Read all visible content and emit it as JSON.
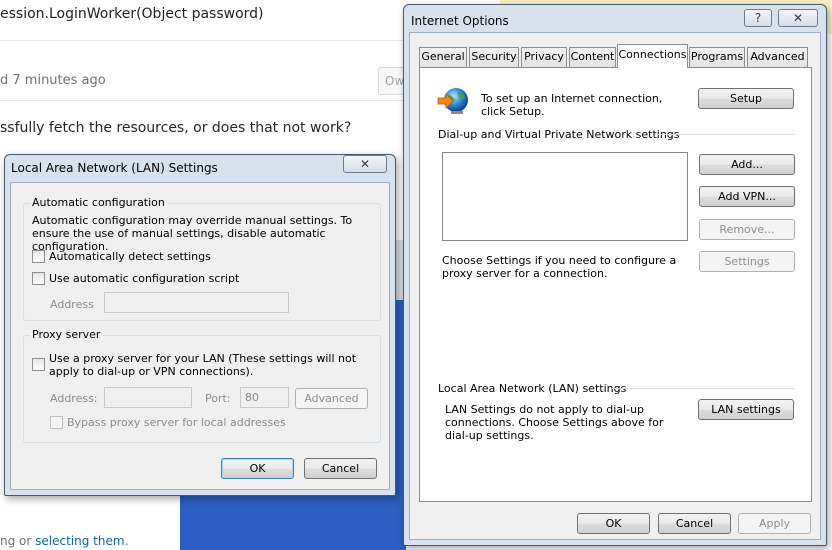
{
  "background": {
    "code_line": "ession.LoginWorker(Object password)",
    "edited": "d 7 minutes ago",
    "owner_button": "Ow",
    "comment": "ssfully fetch the resources, or does that not work?",
    "footer_prefix": "ng or ",
    "footer_link": "selecting them",
    "footer_suffix": "."
  },
  "lan_dialog": {
    "title": "Local Area Network (LAN) Settings",
    "close_glyph": "✕",
    "auto_config": {
      "group_title": "Automatic configuration",
      "description": "Automatic configuration may override manual settings.  To ensure the use of manual settings, disable automatic configuration.",
      "auto_detect_label": "Automatically detect settings",
      "auto_detect_checked": false,
      "script_label": "Use automatic configuration script",
      "script_checked": false,
      "address_label": "Address",
      "address_value": ""
    },
    "proxy": {
      "group_title": "Proxy server",
      "use_proxy_label": "Use a proxy server for your LAN (These settings will not apply to dial-up or VPN connections).",
      "use_proxy_checked": false,
      "address_label": "Address:",
      "address_value": "",
      "port_label": "Port:",
      "port_value": "80",
      "advanced_button": "Advanced",
      "bypass_label": "Bypass proxy server for local addresses",
      "bypass_checked": false
    },
    "ok_button": "OK",
    "cancel_button": "Cancel"
  },
  "internet_options": {
    "title": "Internet Options",
    "help_glyph": "?",
    "close_glyph": "✕",
    "tabs": [
      {
        "label": "General",
        "active": false
      },
      {
        "label": "Security",
        "active": false
      },
      {
        "label": "Privacy",
        "active": false
      },
      {
        "label": "Content",
        "active": false
      },
      {
        "label": "Connections",
        "active": true
      },
      {
        "label": "Programs",
        "active": false
      },
      {
        "label": "Advanced",
        "active": false
      }
    ],
    "setup_text": "To set up an Internet connection, click Setup.",
    "setup_button": "Setup",
    "dialup_section_title": "Dial-up and Virtual Private Network settings",
    "add_button": "Add...",
    "add_vpn_button": "Add VPN...",
    "remove_button": "Remove...",
    "settings_button": "Settings",
    "proxy_hint": "Choose Settings if you need to configure a proxy server for a connection.",
    "lan_section_title": "Local Area Network (LAN) settings",
    "lan_text": "LAN Settings do not apply to dial-up connections. Choose Settings above for dial-up settings.",
    "lan_settings_button": "LAN settings",
    "ok_button": "OK",
    "cancel_button": "Cancel",
    "apply_button": "Apply"
  },
  "icons": {
    "internet_setup": "globe-with-arrow-icon"
  },
  "colors": {
    "window_frame": "#d8e2ef",
    "dialog_face": "#f0f0f0",
    "link_blue": "#0c65a5",
    "taskbar_blue": "#2d5fc3"
  }
}
